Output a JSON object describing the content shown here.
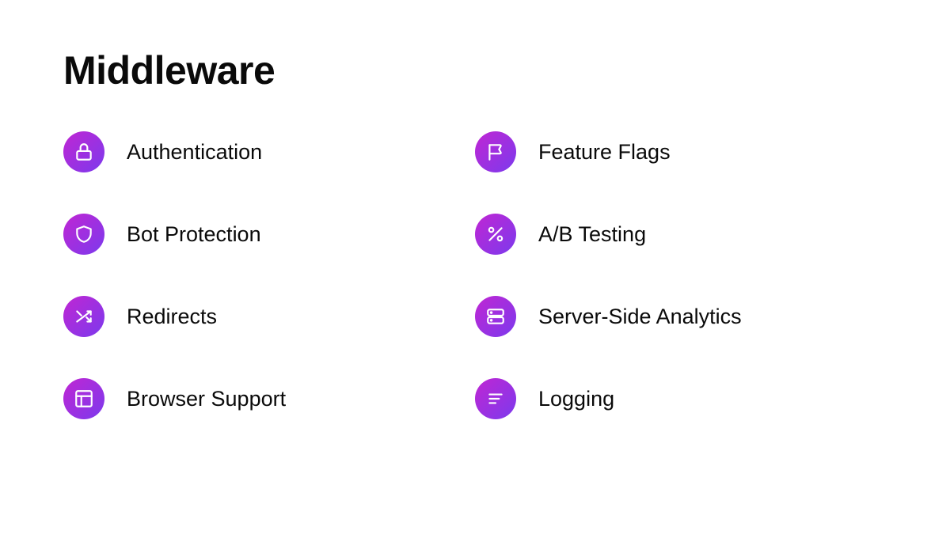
{
  "title": "Middleware",
  "features": [
    {
      "icon": "lock-icon",
      "label": "Authentication"
    },
    {
      "icon": "flag-icon",
      "label": "Feature Flags"
    },
    {
      "icon": "shield-icon",
      "label": "Bot Protection"
    },
    {
      "icon": "percent-icon",
      "label": "A/B Testing"
    },
    {
      "icon": "shuffle-icon",
      "label": "Redirects"
    },
    {
      "icon": "server-icon",
      "label": "Server-Side Analytics"
    },
    {
      "icon": "layout-icon",
      "label": "Browser Support"
    },
    {
      "icon": "logs-icon",
      "label": "Logging"
    }
  ]
}
